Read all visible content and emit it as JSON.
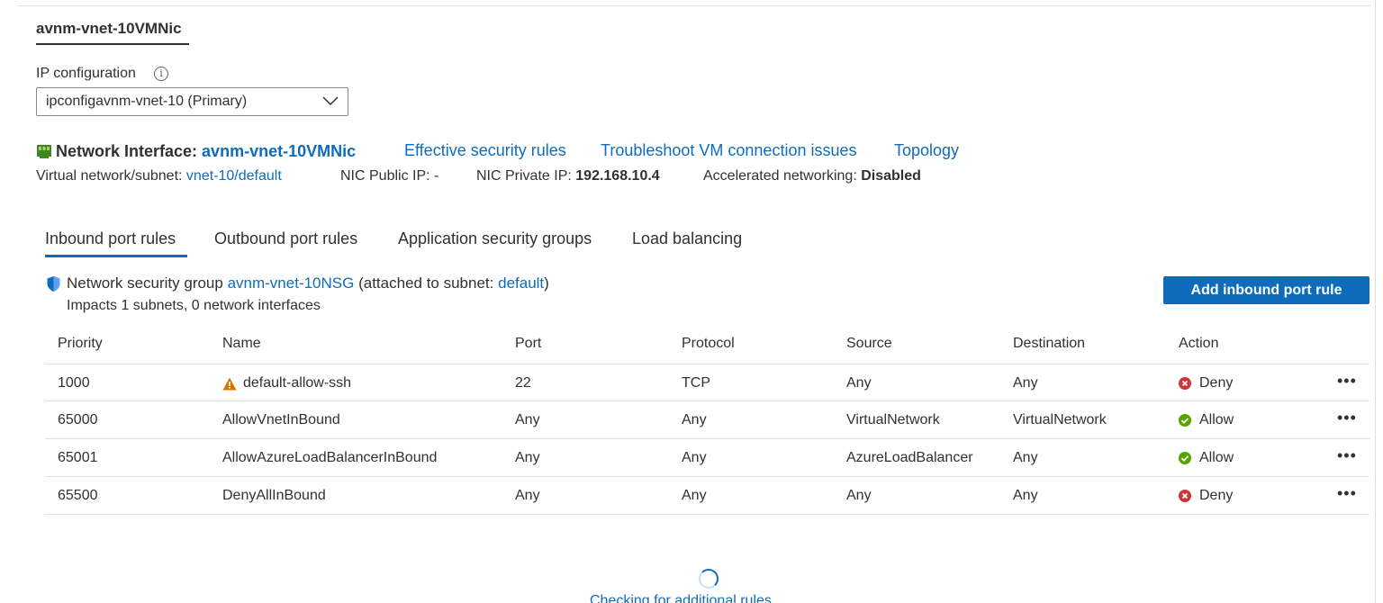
{
  "header": {
    "nic_tab": "avnm-vnet-10VMNic"
  },
  "ip_config": {
    "label": "IP configuration",
    "selected": "ipconfigavnm-vnet-10 (Primary)"
  },
  "nic": {
    "prefix": "Network Interface:",
    "name": "avnm-vnet-10VMNic",
    "links": {
      "effective_rules": "Effective security rules",
      "troubleshoot": "Troubleshoot VM connection issues",
      "topology": "Topology"
    },
    "vnet_label": "Virtual network/subnet:",
    "vnet_value": "vnet-10/default",
    "public_ip_label": "NIC Public IP:",
    "public_ip_value": "-",
    "private_ip_label": "NIC Private IP:",
    "private_ip_value": "192.168.10.4",
    "accel_label": "Accelerated networking:",
    "accel_value": "Disabled"
  },
  "tabs": {
    "inbound": "Inbound port rules",
    "outbound": "Outbound port rules",
    "asg": "Application security groups",
    "lb": "Load balancing"
  },
  "nsg": {
    "prefix": "Network security group",
    "name": "avnm-vnet-10NSG",
    "attached_prefix": "(attached to subnet:",
    "subnet": "default",
    "attached_suffix": ")",
    "impacts": "Impacts 1 subnets, 0 network interfaces",
    "add_button": "Add inbound port rule"
  },
  "table": {
    "headers": {
      "priority": "Priority",
      "name": "Name",
      "port": "Port",
      "protocol": "Protocol",
      "source": "Source",
      "destination": "Destination",
      "action": "Action"
    },
    "rows": [
      {
        "priority": "1000",
        "name": "default-allow-ssh",
        "warning": true,
        "port": "22",
        "protocol": "TCP",
        "source": "Any",
        "destination": "Any",
        "action": "Deny"
      },
      {
        "priority": "65000",
        "name": "AllowVnetInBound",
        "warning": false,
        "port": "Any",
        "protocol": "Any",
        "source": "VirtualNetwork",
        "destination": "VirtualNetwork",
        "action": "Allow"
      },
      {
        "priority": "65001",
        "name": "AllowAzureLoadBalancerInBound",
        "warning": false,
        "port": "Any",
        "protocol": "Any",
        "source": "AzureLoadBalancer",
        "destination": "Any",
        "action": "Allow"
      },
      {
        "priority": "65500",
        "name": "DenyAllInBound",
        "warning": false,
        "port": "Any",
        "protocol": "Any",
        "source": "Any",
        "destination": "Any",
        "action": "Deny"
      }
    ],
    "more_label": "•••"
  },
  "footer": {
    "checking": "Checking for additional rules..."
  },
  "colors": {
    "accent": "#0f6cbd",
    "deny": "#d13438",
    "allow": "#57a300",
    "warning": "#d47500"
  }
}
